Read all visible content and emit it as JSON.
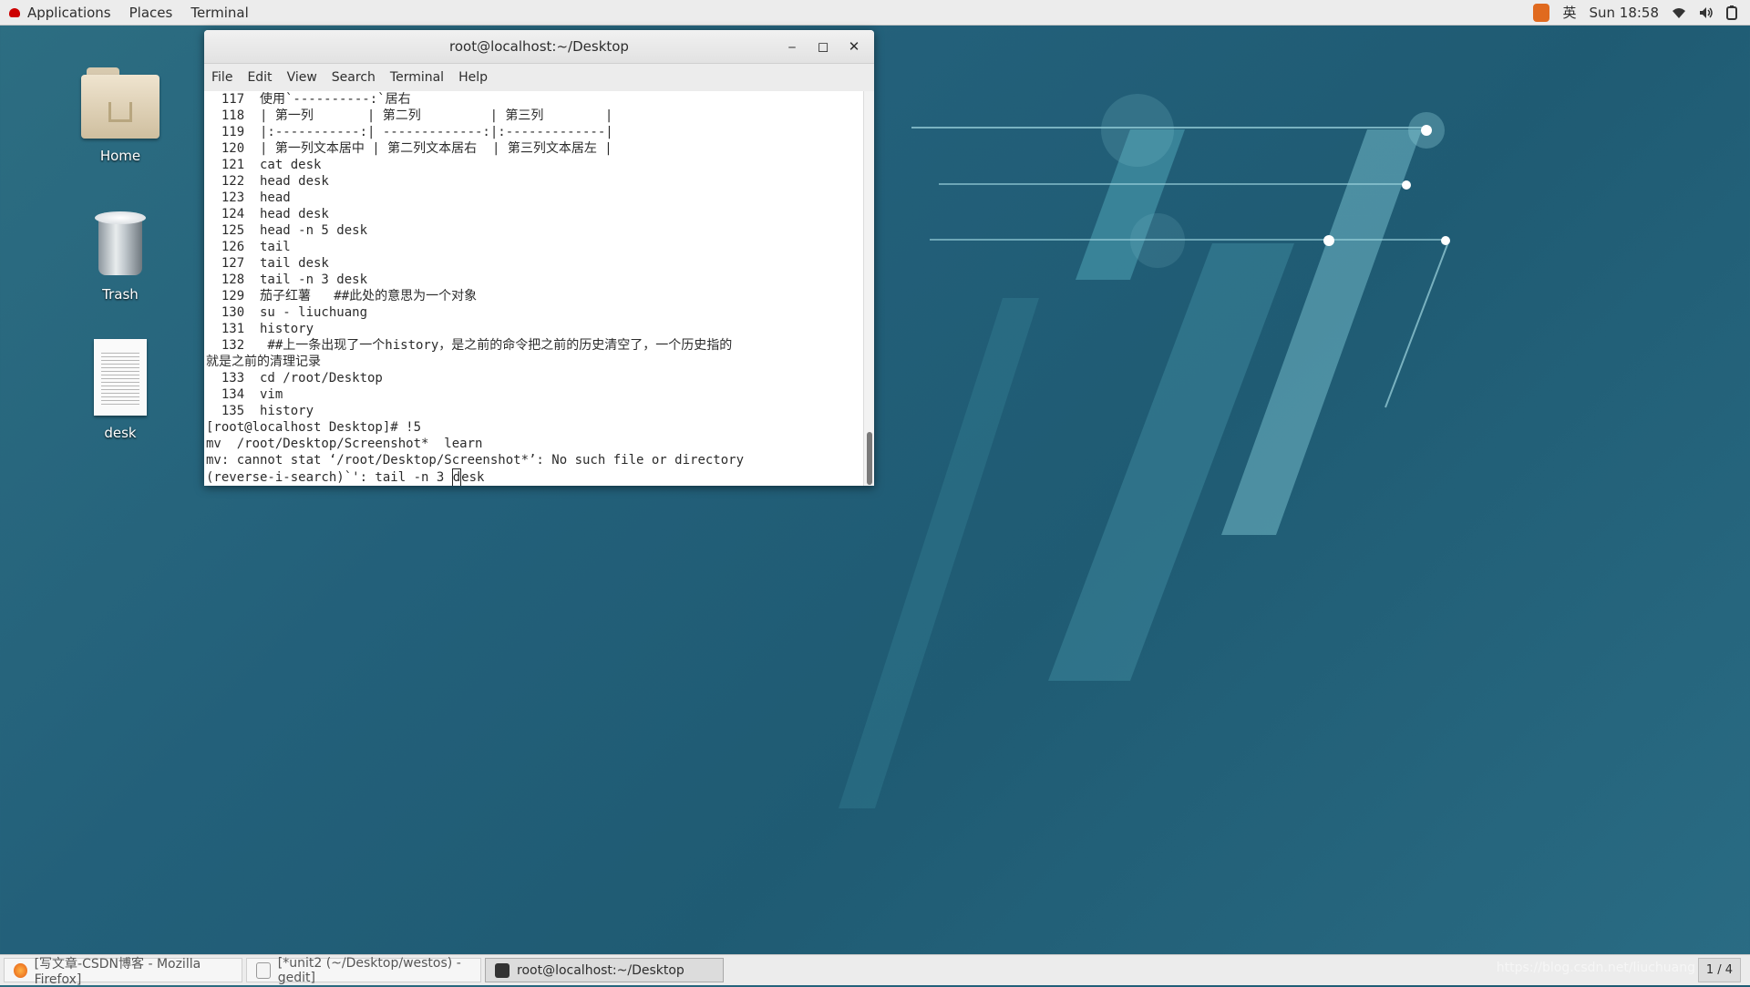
{
  "topbar": {
    "applications": "Applications",
    "places": "Places",
    "terminal": "Terminal",
    "ime": "英",
    "clock": "Sun 18:58"
  },
  "desktop": {
    "home": "Home",
    "trash": "Trash",
    "desk": "desk"
  },
  "window": {
    "title": "root@localhost:~/Desktop",
    "menu": [
      "File",
      "Edit",
      "View",
      "Search",
      "Terminal",
      "Help"
    ],
    "lines": [
      "  117  使用`----------:`居右",
      "  118  | 第一列       | 第二列         | 第三列        |",
      "  119  |:-----------:| -------------:|:-------------|",
      "  120  | 第一列文本居中 | 第二列文本居右  | 第三列文本居左 |",
      "  121  cat desk",
      "  122  head desk",
      "  123  head",
      "  124  head desk",
      "  125  head -n 5 desk",
      "  126  tail",
      "  127  tail desk",
      "  128  tail -n 3 desk",
      "  129  茄子红薯   ##此处的意思为一个对象",
      "  130  su - liuchuang",
      "  131  history",
      "  132   ##上一条出现了一个history，是之前的命令把之前的历史清空了，一个历史指的",
      "就是之前的清理记录",
      "  133  cd /root/Desktop",
      "  134  vim",
      "  135  history",
      "[root@localhost Desktop]# !5",
      "mv  /root/Desktop/Screenshot*  learn",
      "mv: cannot stat ‘/root/Desktop/Screenshot*’: No such file or directory"
    ],
    "search_prefix": "(reverse-i-search)`': tail -n 3 ",
    "search_cursor": "d",
    "search_suffix": "esk"
  },
  "taskbar": {
    "firefox": "[写文章-CSDN博客 - Mozilla Firefox]",
    "gedit": "[*unit2 (~/Desktop/westos) - gedit]",
    "terminal": "root@localhost:~/Desktop",
    "pager": "1 / 4",
    "watermark": "https://blog.csdn.net/liuchuang"
  }
}
